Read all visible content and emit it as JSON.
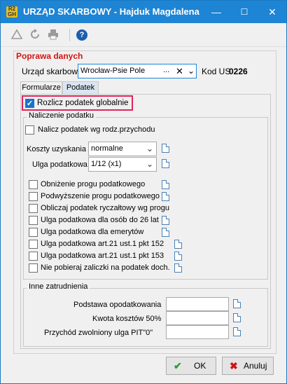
{
  "window": {
    "app_badge": "R2 GH",
    "title": "URZĄD SKARBOWY - Hajduk Magdalena",
    "minimize": "—",
    "maximize": "☐",
    "close": "✕"
  },
  "toolbar": {
    "icons": [
      "warning-icon",
      "refresh-icon",
      "print-icon",
      "help-icon"
    ],
    "help_glyph": "?"
  },
  "form": {
    "section_title": "Poprawa danych",
    "office_label": "Urząd skarbowy",
    "office_value": "Wrocław-Psie Pole",
    "office_dots": "...",
    "code_label": "Kod US",
    "code_value": "0226",
    "tabs": [
      {
        "label": "Formularze",
        "active": false
      },
      {
        "label": "Podatek",
        "active": true
      }
    ]
  },
  "podatek": {
    "global_label": "Rozlicz podatek globalnie",
    "global_checked": true,
    "naliczenie": {
      "title": "Naliczenie podatku",
      "calc_label": "Nalicz podatek wg rodz.przychodu",
      "koszty_label": "Koszty uzyskania",
      "koszty_value": "normalne",
      "ulga_label": "Ulga podatkowa",
      "ulga_value": "1/12 (x1)",
      "options": [
        "Obniżenie progu podatkowego",
        "Podwyższenie progu podatkowego",
        "Obliczaj podatek ryczałtowy wg progu",
        "Ulga podatkowa dla osób do 26 lat",
        "Ulga podatkowa dla emerytów",
        "Ulga podatkowa art.21 ust.1 pkt 152",
        "Ulga podatkowa art.21 ust.1 pkt 153",
        "Nie pobieraj zaliczki na podatek doch."
      ]
    },
    "inne": {
      "title": "Inne zatrudnienia",
      "fields": [
        {
          "label": "Podstawa opodatkowania",
          "value": ""
        },
        {
          "label": "Kwota kosztów 50%",
          "value": ""
        },
        {
          "label": "Przychód zwolniony ulga PIT\"0\"",
          "value": ""
        }
      ]
    }
  },
  "buttons": {
    "ok": "OK",
    "ok_icon": "✔",
    "cancel": "Anuluj",
    "cancel_icon": "✖"
  },
  "colors": {
    "titlebar": "#1e84d4",
    "section_title": "#d4140f",
    "highlight": "#e0245c",
    "checkbox_checked": "#1a73c8"
  }
}
